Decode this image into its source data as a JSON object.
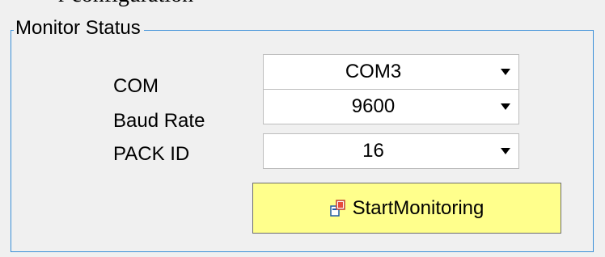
{
  "header_partial_text": "r configuration",
  "group": {
    "title": "Monitor Status"
  },
  "fields": [
    {
      "label": "COM",
      "value": "COM3"
    },
    {
      "label": "Baud Rate",
      "value": "9600"
    },
    {
      "label": "PACK ID",
      "value": "16"
    }
  ],
  "start_button": {
    "label": "StartMonitoring",
    "icon": "connect-icon",
    "background_color": "#ffff8c"
  },
  "colors": {
    "group_border": "#3a8fd8",
    "window_background": "#f0f0f0"
  }
}
